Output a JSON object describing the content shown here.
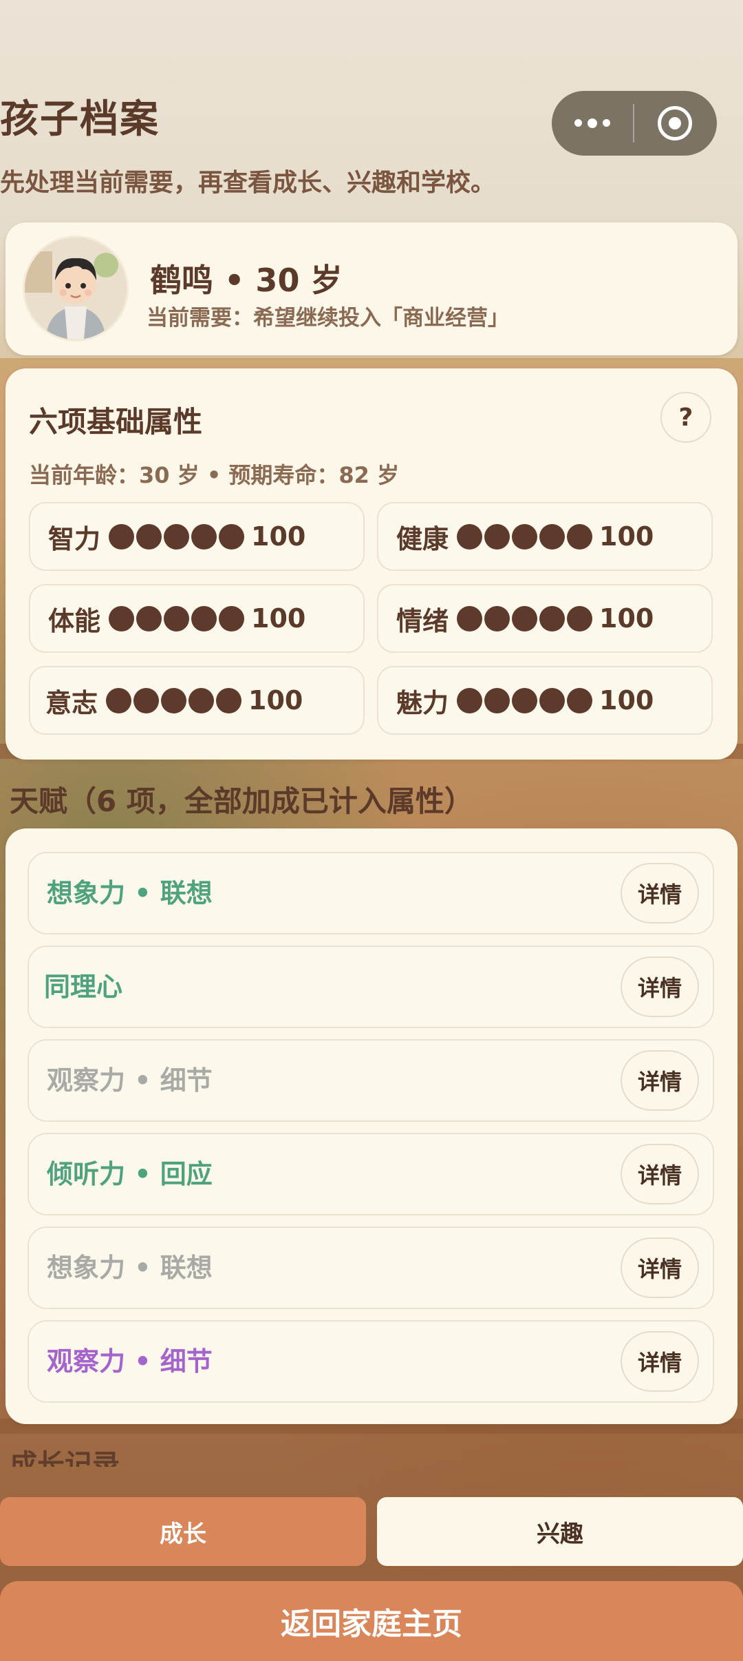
{
  "header": {
    "title": "孩子档案",
    "subtitle": "先处理当前需要，再查看成长、兴趣和学校。"
  },
  "capsule": {
    "more_icon": "more-dots-icon",
    "close_icon": "target-circle-icon"
  },
  "profile": {
    "name_age": "鹤鸣 • 30 岁",
    "need": "当前需要：希望继续投入「商业经营」"
  },
  "attributes": {
    "title": "六项基础属性",
    "help_label": "?",
    "age_line": "当前年龄：30 岁 • 预期寿命：82 岁",
    "items": [
      {
        "label": "智力",
        "value": "100",
        "dots": 5
      },
      {
        "label": "健康",
        "value": "100",
        "dots": 5
      },
      {
        "label": "体能",
        "value": "100",
        "dots": 5
      },
      {
        "label": "情绪",
        "value": "100",
        "dots": 5
      },
      {
        "label": "意志",
        "value": "100",
        "dots": 5
      },
      {
        "label": "魅力",
        "value": "100",
        "dots": 5
      }
    ]
  },
  "talents": {
    "heading": "天赋（6 项，全部加成已计入属性）",
    "detail_label": "详情",
    "items": [
      {
        "label": "想象力 • 联想",
        "color": "#4fa27e"
      },
      {
        "label": "同理心",
        "color": "#4fa27e"
      },
      {
        "label": "观察力 • 细节",
        "color": "#a9aaa6"
      },
      {
        "label": "倾听力 • 回应",
        "color": "#4fa27e"
      },
      {
        "label": "想象力 • 联想",
        "color": "#a9aaa6"
      },
      {
        "label": "观察力 • 细节",
        "color": "#a564cc"
      }
    ]
  },
  "growth_heading": "成长记录",
  "tabs": {
    "growth": "成长",
    "interest": "兴趣"
  },
  "home_button": "返回家庭主页",
  "colors": {
    "accent": "#d9875a",
    "text_dark": "#5b3a2a",
    "card_bg": "#fdf7ea"
  }
}
